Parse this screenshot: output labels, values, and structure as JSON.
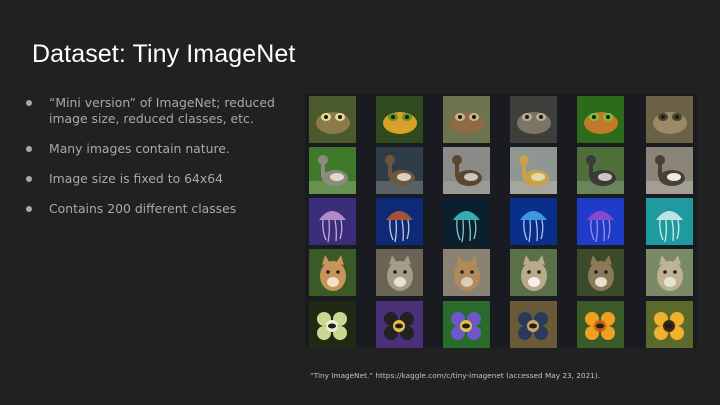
{
  "slide": {
    "title": "Dataset: Tiny ImageNet",
    "bullets": [
      "“Mini version” of ImageNet; reduced image size, reduced classes, etc.",
      "Many images contain nature.",
      "Image size is fixed to 64x64",
      "Contains 200 different classes"
    ],
    "citation": "“Tiny ImageNet.” https://kaggle.com/c/tiny-imagenet (accessed May 23, 2021)."
  },
  "colors": {
    "background": "#212121",
    "title": "#ffffff",
    "bullet_text": "#a9a9a9",
    "citation_text": "#c4c4c4",
    "grid_background": "#1a1b20"
  },
  "image_grid": {
    "rows": [
      {
        "subject": "frogs",
        "tiles": [
          {
            "icon": "toad-image-icon",
            "bg": "#4b5a2c",
            "fg": "#8a7b48",
            "accent": "#e5d9a0",
            "shape": "blob"
          },
          {
            "icon": "yellow-frog-image-icon",
            "bg": "#2f4a1e",
            "fg": "#d6a22a",
            "accent": "#6b8f2c",
            "shape": "blob"
          },
          {
            "icon": "brown-frog-image-icon",
            "bg": "#6d7450",
            "fg": "#8f6a45",
            "accent": "#c6b48a",
            "shape": "blob"
          },
          {
            "icon": "grey-toad-image-icon",
            "bg": "#3e3f3a",
            "fg": "#7b7565",
            "accent": "#b5ad9a",
            "shape": "blob"
          },
          {
            "icon": "tree-frog-image-icon",
            "bg": "#2d6b1c",
            "fg": "#c27a2a",
            "accent": "#7cc23a",
            "shape": "blob"
          },
          {
            "icon": "camouflaged-frog-image-icon",
            "bg": "#6b6146",
            "fg": "#9a8b66",
            "accent": "#4b4535",
            "shape": "blob"
          }
        ]
      },
      {
        "subject": "geese",
        "tiles": [
          {
            "icon": "goose-on-grass-image-icon",
            "bg": "#3f7a2a",
            "fg": "#8e8a80",
            "accent": "#e0d8c8",
            "shape": "bird"
          },
          {
            "icon": "swimming-duck-image-icon",
            "bg": "#2f3d48",
            "fg": "#6b5640",
            "accent": "#d8d0c0",
            "shape": "bird"
          },
          {
            "icon": "duck-on-pavement-image-icon",
            "bg": "#8a8a88",
            "fg": "#5a4630",
            "accent": "#c9c6bf",
            "shape": "bird"
          },
          {
            "icon": "ducklings-image-icon",
            "bg": "#8f9795",
            "fg": "#c8a24a",
            "accent": "#e2d9a8",
            "shape": "bird"
          },
          {
            "icon": "geese-flock-image-icon",
            "bg": "#4e6e3a",
            "fg": "#3a3a36",
            "accent": "#c8c8c0",
            "shape": "bird"
          },
          {
            "icon": "canada-goose-image-icon",
            "bg": "#8a8578",
            "fg": "#4a3f35",
            "accent": "#eceae2",
            "shape": "bird"
          }
        ]
      },
      {
        "subject": "jellyfish",
        "tiles": [
          {
            "icon": "purple-jellyfish-image-icon",
            "bg": "#3c2d7a",
            "fg": "#c59bd8",
            "accent": "#e8c8f0",
            "shape": "jelly"
          },
          {
            "icon": "orange-jellyfish-image-icon",
            "bg": "#0c2a78",
            "fg": "#c05a2a",
            "accent": "#f0f0f0",
            "shape": "jelly"
          },
          {
            "icon": "comb-jelly-image-icon",
            "bg": "#0b1f2e",
            "fg": "#3ec8c8",
            "accent": "#a0f0f0",
            "shape": "jelly"
          },
          {
            "icon": "blue-jellyfish-image-icon",
            "bg": "#0a2f8a",
            "fg": "#4aa8f0",
            "accent": "#d0e8ff",
            "shape": "jelly"
          },
          {
            "icon": "deep-sea-jellyfish-image-icon",
            "bg": "#1e3cc8",
            "fg": "#9a4ad0",
            "accent": "#c0a0f0",
            "shape": "jelly"
          },
          {
            "icon": "pale-jellyfish-image-icon",
            "bg": "#1f9aa0",
            "fg": "#d8f0f0",
            "accent": "#ffffff",
            "shape": "jelly"
          }
        ]
      },
      {
        "subject": "cougars",
        "tiles": [
          {
            "icon": "cougar-face-image-icon",
            "bg": "#3a5a28",
            "fg": "#c8945a",
            "accent": "#f0e0c8",
            "shape": "cat"
          },
          {
            "icon": "snarling-cougar-image-icon",
            "bg": "#6a6458",
            "fg": "#a69a88",
            "accent": "#e8e0d0",
            "shape": "cat"
          },
          {
            "icon": "caged-cougar-image-icon",
            "bg": "#8a8272",
            "fg": "#b08a5a",
            "accent": "#d8cdb8",
            "shape": "cat"
          },
          {
            "icon": "tan-cougar-image-icon",
            "bg": "#5a7048",
            "fg": "#b8ab8a",
            "accent": "#f4f0e8",
            "shape": "cat"
          },
          {
            "icon": "cougar-on-rock-image-icon",
            "bg": "#3a4a2a",
            "fg": "#8a7a5a",
            "accent": "#e6e0d2",
            "shape": "cat"
          },
          {
            "icon": "lying-cougar-image-icon",
            "bg": "#7a8a68",
            "fg": "#c0b294",
            "accent": "#e8e2d4",
            "shape": "cat"
          }
        ]
      },
      {
        "subject": "bees",
        "tiles": [
          {
            "icon": "bee-on-leaves-image-icon",
            "bg": "#1f2a14",
            "fg": "#c8d890",
            "accent": "#f0f0d0",
            "shape": "flower"
          },
          {
            "icon": "bumblebee-on-thistle-image-icon",
            "bg": "#4a3078",
            "fg": "#222222",
            "accent": "#e8c040",
            "shape": "flower"
          },
          {
            "icon": "bee-on-purple-flower-image-icon",
            "bg": "#2a6a2a",
            "fg": "#6a58c8",
            "accent": "#e8c040",
            "shape": "flower"
          },
          {
            "icon": "bee-on-tree-bark-image-icon",
            "bg": "#6a5a38",
            "fg": "#2a3a5a",
            "accent": "#c8a860",
            "shape": "flower"
          },
          {
            "icon": "bee-on-yellow-flower-image-icon",
            "bg": "#3a5a28",
            "fg": "#f0a020",
            "accent": "#c86010",
            "shape": "flower"
          },
          {
            "icon": "bee-on-orange-flower-image-icon",
            "bg": "#5a6a2a",
            "fg": "#f0b030",
            "accent": "#3a2a10",
            "shape": "flower"
          }
        ]
      }
    ]
  }
}
